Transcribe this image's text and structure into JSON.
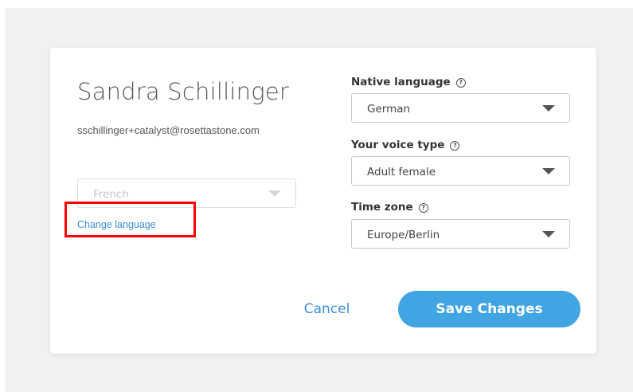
{
  "profile": {
    "name": "Sandra Schillinger",
    "email": "sschillinger+catalyst@rosettastone.com",
    "learning_language": "French",
    "change_language_link": "Change language"
  },
  "settings": {
    "native_language": {
      "label": "Native language",
      "value": "German"
    },
    "voice_type": {
      "label": "Your voice type",
      "value": "Adult female"
    },
    "time_zone": {
      "label": "Time zone",
      "value": "Europe/Berlin"
    },
    "help_glyph": "?"
  },
  "actions": {
    "cancel_label": "Cancel",
    "save_label": "Save Changes"
  },
  "colors": {
    "accent": "#41a4e3",
    "link": "#3a8fd4",
    "highlight": "#ff0000"
  }
}
